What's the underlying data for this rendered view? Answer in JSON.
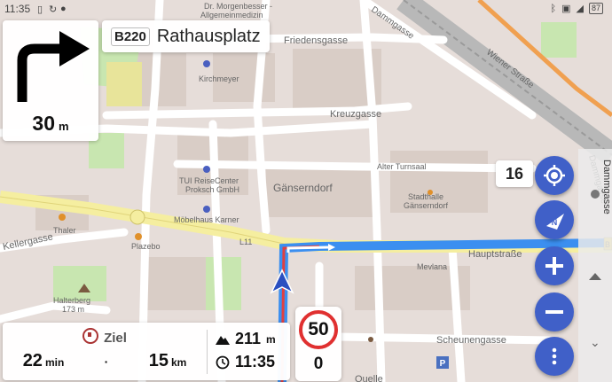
{
  "status_bar": {
    "time": "11:35",
    "battery": "87",
    "icons": [
      "notification-icon",
      "navigation-app-icon",
      "location-icon",
      "bluetooth-icon",
      "vibrate-icon",
      "wifi-icon",
      "battery-icon"
    ]
  },
  "turn_instruction": {
    "direction": "right",
    "icon": "turn-right-arrow-icon",
    "distance_value": "30",
    "distance_unit": "m"
  },
  "next_street": {
    "road_ref": "B220",
    "name": "Rathausplatz"
  },
  "map": {
    "zoom_level": "16",
    "labels": {
      "friedensgasse": "Friedensgasse",
      "dammgasse": "Dammgasse",
      "wiener_strasse": "Wiener Straße",
      "dammgasse_side": "Dammgasse",
      "poi_morgenbesser": "Dr. Morgenbesser -",
      "poi_allgemein": "Allgemeinmedizin",
      "poi_kirchmeyer": "Kirchmeyer",
      "kreuzgasse": "Kreuzgasse",
      "alter_turnsaal": "Alter Turnsaal",
      "poi_tui1": "TUI ReiseCenter",
      "poi_tui2": "Proksch GmbH",
      "gaenserndorf": "Gänserndorf",
      "stadthalle1": "Stadthalle",
      "stadthalle2": "Gänserndorf",
      "moebelhaus": "Möbelhaus Karner",
      "thaler": "Thaler",
      "kellergasse": "Kellergasse",
      "plazebo": "Plazebo",
      "l11": "L11",
      "hauptstrasse": "Hauptstraße",
      "mevlana": "Mevlana",
      "halterberg": "Halterberg",
      "halterberg_alt": "173 m",
      "scheunengasse": "Scheunengasse",
      "quellen": "Quelle",
      "b_badge": "B"
    }
  },
  "map_controls": {
    "locate": "my-location-icon",
    "compass": "compass-icon",
    "zoom_in": "plus-icon",
    "zoom_out": "minus-icon",
    "menu": "more-vert-icon"
  },
  "route_info": {
    "destination_label": "Ziel",
    "time_value": "22",
    "time_unit": "min",
    "separator": "·",
    "distance_value": "15",
    "distance_unit": "km",
    "elevation_value": "211",
    "elevation_unit": "m",
    "arrival_time": "11:35"
  },
  "speed": {
    "limit": "50",
    "current": "0"
  },
  "colors": {
    "route_blue": "#3b8ff0",
    "fab_blue": "#4060c8",
    "speed_sign_red": "#e03030",
    "main_road_yellow": "#f5eea0",
    "park_green": "#c8e6b0"
  }
}
